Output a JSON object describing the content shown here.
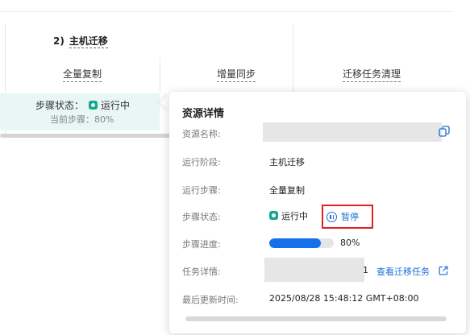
{
  "workflow": {
    "stage_number": "2)",
    "stage_name": "主机迁移",
    "steps": [
      "全量复制",
      "增量同步",
      "迁移任务清理"
    ],
    "card": {
      "status_label": "步骤状态：",
      "status_value": "运行中",
      "current_step_label": "当前步骤：",
      "current_step_value": "80%"
    }
  },
  "popover": {
    "title": "资源详情",
    "rows": {
      "resource_name_label": "资源名称:",
      "stage_label": "运行阶段:",
      "stage_value": "主机迁移",
      "step_label": "运行步骤:",
      "step_value": "全量复制",
      "status_label": "步骤状态:",
      "status_value": "运行中",
      "progress_label": "步骤进度:",
      "progress_value": "80%",
      "progress_fraction": 0.8,
      "task_label": "任务详情:",
      "task_tail": "1",
      "task_link": "查看迁移任务",
      "updated_label": "最后更新时间:",
      "updated_value": "2025/08/28 15:48:12 GMT+08:00"
    },
    "pause_label": "暂停"
  },
  "colors": {
    "accent": "#1670e8",
    "status_green": "#16a58f",
    "highlight_red": "#e02020",
    "card_bg": "#e8f6f4"
  },
  "icons": {
    "status": "running-status-icon",
    "pause": "pause-circle-icon",
    "copy": "copy-icon",
    "external": "external-link-icon"
  }
}
